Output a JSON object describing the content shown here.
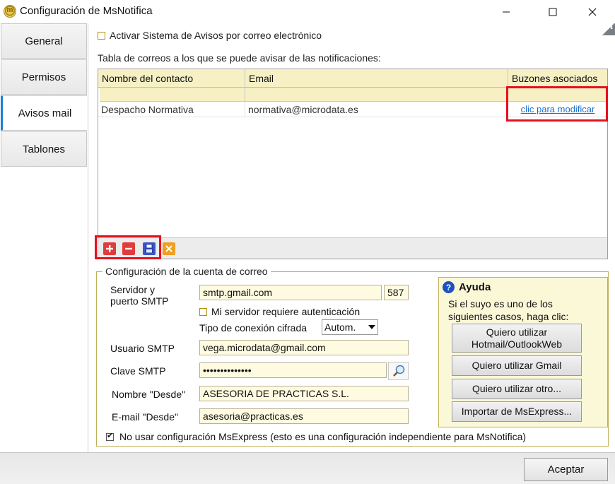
{
  "window": {
    "title": "Configuración de MsNotifica",
    "icon": "msnotifica-app-icon",
    "controls": [
      "minimize-icon",
      "maximize-icon",
      "close-icon"
    ]
  },
  "tabs": [
    {
      "label": "General",
      "active": false
    },
    {
      "label": "Permisos",
      "active": false
    },
    {
      "label": "Avisos mail",
      "active": true
    },
    {
      "label": "Tablones",
      "active": false
    }
  ],
  "activar": {
    "label": "Activar Sistema de Avisos por correo electrónico",
    "checked": false
  },
  "tabla_label": "Tabla de correos a los que se puede avisar de las notificaciones:",
  "grid": {
    "columns": [
      "Nombre del contacto",
      "Email",
      "Buzones asociados"
    ],
    "rows": [
      {
        "nombre": "Despacho Normativa",
        "email": "normativa@microdata.es",
        "buzones": "clic para modificar"
      }
    ],
    "toolbar": [
      "add-icon",
      "delete-icon",
      "save-icon",
      "cancel-icon"
    ]
  },
  "cuenta": {
    "legend": "Configuración de la cuenta de correo",
    "servidor_label_1": "Servidor y",
    "servidor_label_2": "puerto SMTP",
    "servidor": "smtp.gmail.com",
    "puerto": "587",
    "auth_label": "Mi servidor requiere autenticación",
    "auth_checked": false,
    "cifrado_label": "Tipo de conexión cifrada",
    "cifrado_value": "Autom.",
    "usuario_label": "Usuario SMTP",
    "usuario": "vega.microdata@gmail.com",
    "clave_label": "Clave SMTP",
    "clave": "••••••••••••••",
    "nombre_label": "Nombre \"Desde\"",
    "nombre": "ASESORIA DE PRACTICAS S.L.",
    "email_label": "E-mail \"Desde\"",
    "email": "asesoria@practicas.es",
    "no_usar_label": "No usar configuración MsExpress (esto es una configuración independiente para MsNotifica)",
    "no_usar_checked": true
  },
  "ayuda": {
    "title": "Ayuda",
    "text": "Si el suyo es uno de los siguientes casos, haga clic:",
    "buttons": {
      "hotmail_1": "Quiero utilizar",
      "hotmail_2": "Hotmail/OutlookWeb",
      "gmail": "Quiero utilizar Gmail",
      "otro": "Quiero utilizar otro...",
      "importar": "Importar de MsExpress..."
    }
  },
  "footer": {
    "aceptar": "Aceptar"
  },
  "colors": {
    "highlight_box": "#e8101e",
    "grid_header": "#f6f0c4",
    "field_bg": "#fffbe0",
    "active_tab": "#1a7fd4",
    "link": "#1a6fd0"
  }
}
